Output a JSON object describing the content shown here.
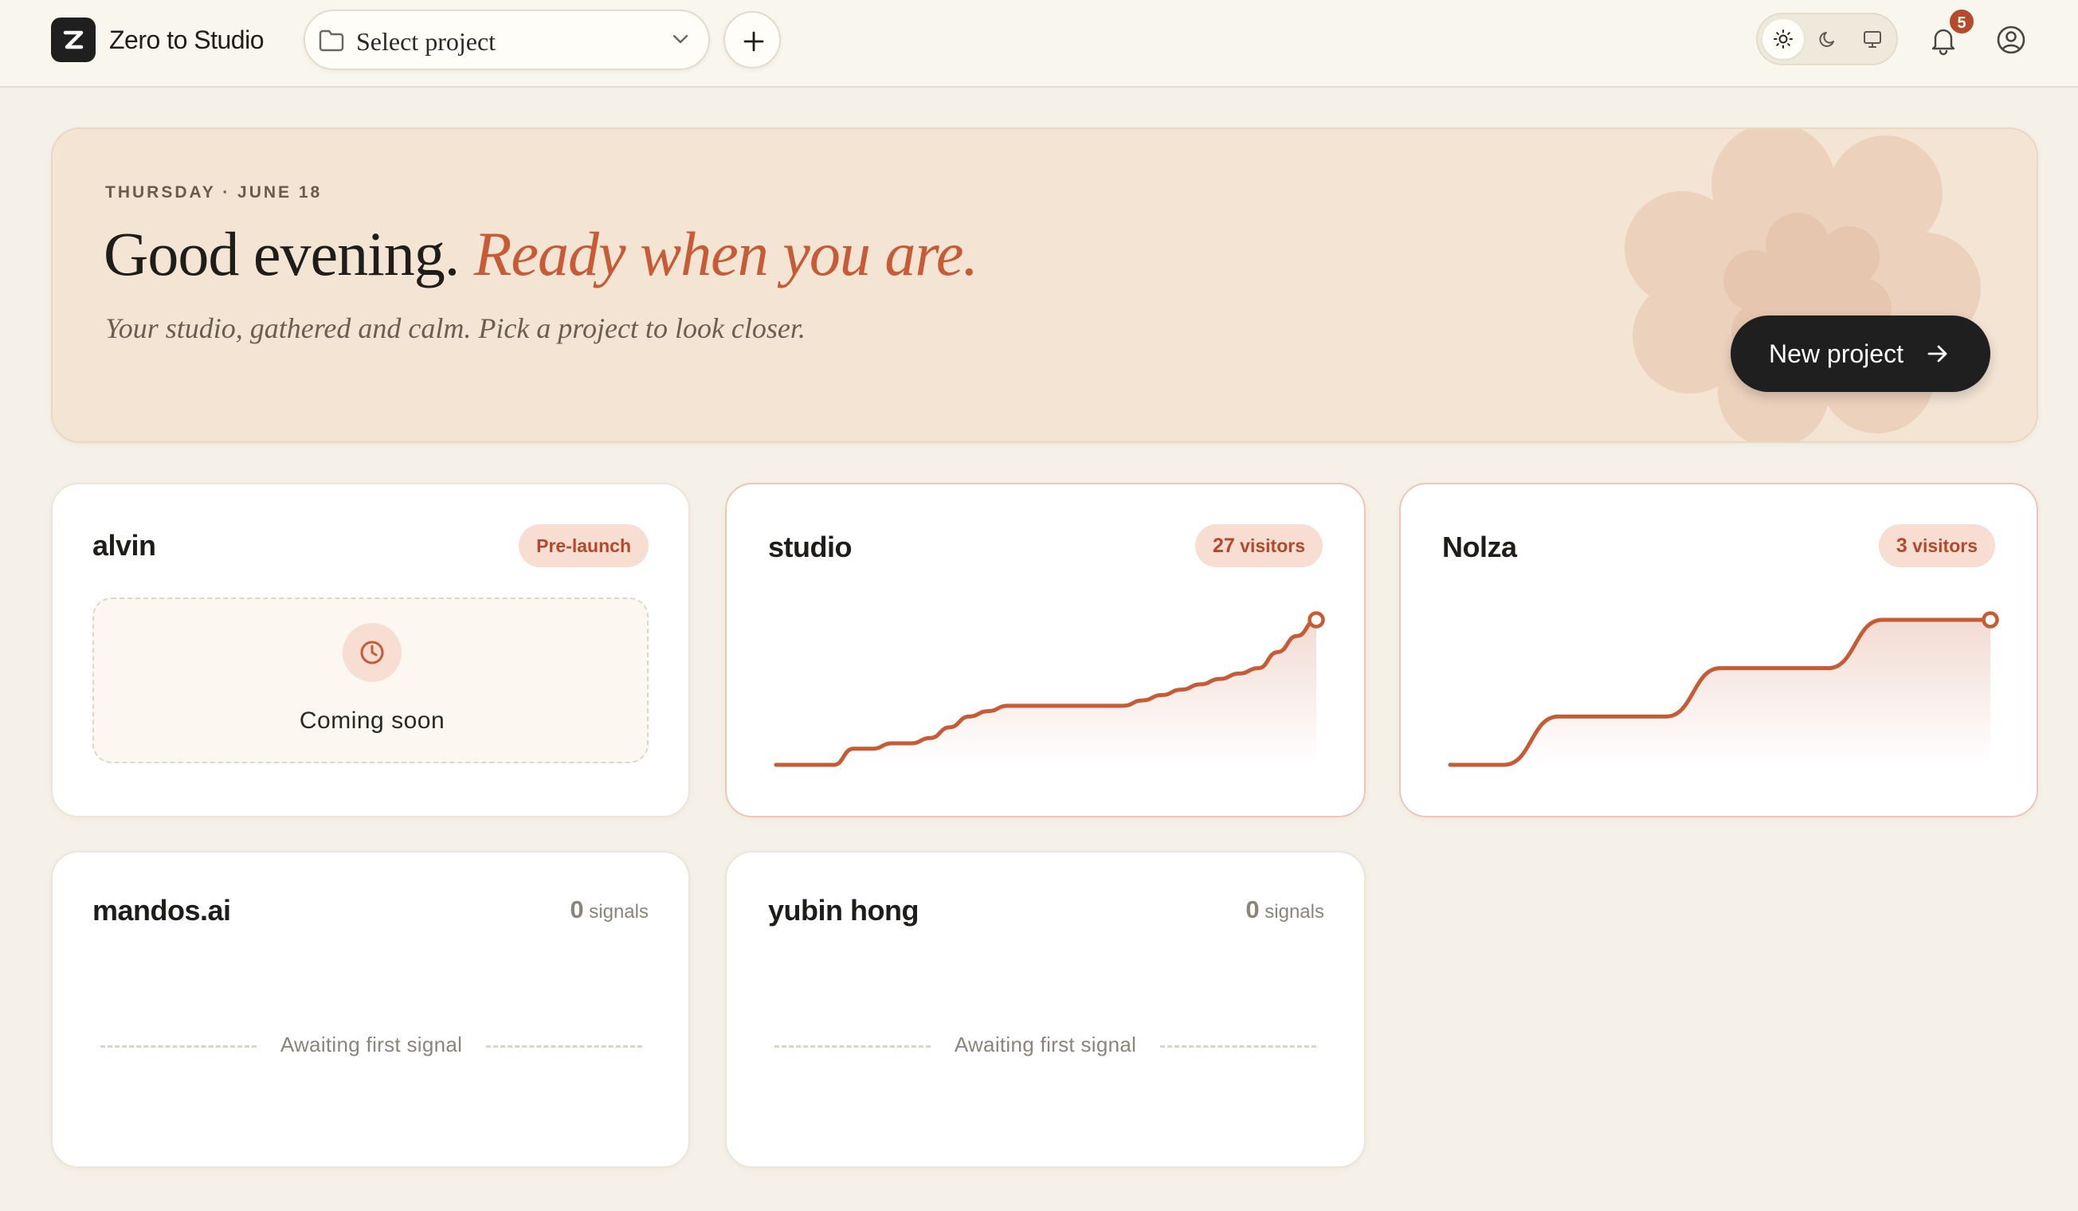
{
  "header": {
    "app_title": "Zero to Studio",
    "project_select": {
      "label": "Select project"
    },
    "notifications": {
      "count": "5"
    },
    "theme_options": [
      "light",
      "dark",
      "system"
    ],
    "active_theme": "light"
  },
  "hero": {
    "date": "THURSDAY · JUNE 18",
    "greeting": "Good evening.",
    "greeting_accent": "Ready when you are.",
    "subtitle": "Your studio, gathered and calm. Pick a project to look closer.",
    "cta_label": "New project"
  },
  "colors": {
    "accent": "#c75b35",
    "pill_bg": "#f7ddd2",
    "pill_text": "#b4482a",
    "hero_bg": "#f3e4d4",
    "page_bg": "#f5f1e8"
  },
  "projects": [
    {
      "name": "alvin",
      "status": "Pre-launch",
      "placeholder": "Coming soon"
    },
    {
      "name": "studio",
      "metric_value": "27",
      "metric_unit": "visitors"
    },
    {
      "name": "Nolza",
      "metric_value": "3",
      "metric_unit": "visitors"
    },
    {
      "name": "mandos.ai",
      "metric_value": "0",
      "metric_unit": "signals",
      "empty_text": "Awaiting first signal"
    },
    {
      "name": "yubin hong",
      "metric_value": "0",
      "metric_unit": "signals",
      "empty_text": "Awaiting first signal"
    }
  ],
  "chart_data": [
    {
      "type": "area",
      "project": "studio",
      "x": [
        0,
        1,
        2,
        3,
        4,
        5,
        6,
        7,
        8,
        9,
        10,
        11,
        12,
        13,
        14,
        15,
        16,
        17,
        18,
        19,
        20,
        21,
        22,
        23,
        24,
        25,
        26,
        27,
        28
      ],
      "y": [
        0,
        0,
        0,
        0,
        3,
        3,
        4,
        4,
        5,
        7,
        9,
        10,
        11,
        11,
        11,
        11,
        11,
        11,
        11,
        12,
        13,
        14,
        15,
        16,
        17,
        18,
        21,
        24,
        27
      ],
      "ylim": [
        0,
        27
      ],
      "grid": false
    },
    {
      "type": "area",
      "project": "Nolza",
      "x": [
        0,
        1,
        2,
        3,
        4,
        5,
        6,
        7,
        8,
        9,
        10
      ],
      "y": [
        0,
        0,
        1,
        1,
        1,
        2,
        2,
        2,
        3,
        3,
        3
      ],
      "ylim": [
        0,
        3
      ],
      "grid": false
    }
  ]
}
